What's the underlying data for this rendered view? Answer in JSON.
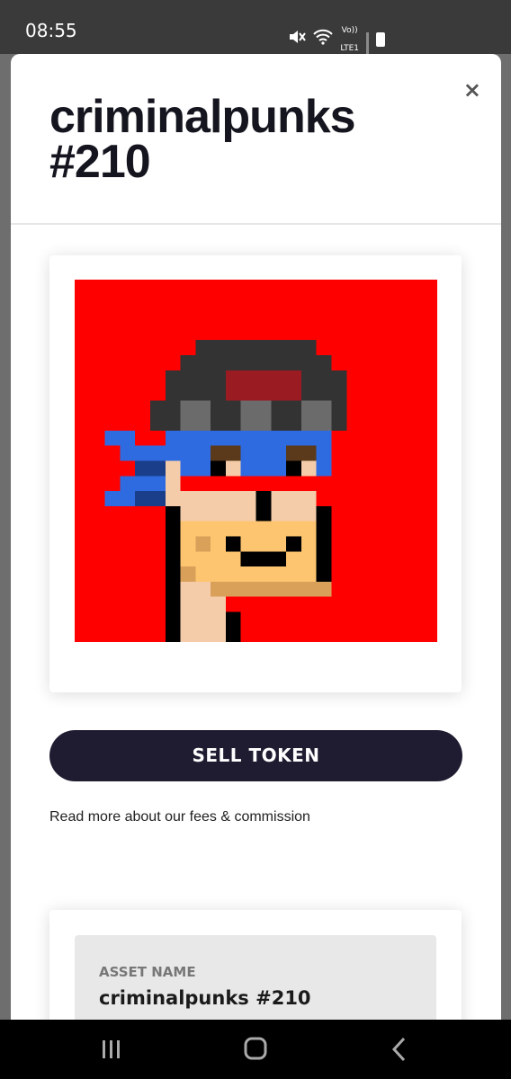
{
  "status_bar": {
    "time": "08:55",
    "icons": [
      "mute-icon",
      "wifi-icon",
      "volte-icon",
      "signal-icon",
      "battery-icon"
    ],
    "volte_top": "Vo))",
    "volte_bottom": "LTE1"
  },
  "sheet": {
    "title": "criminalpunks #210",
    "close_label": "×"
  },
  "nft": {
    "background": "#ff0000",
    "alt": "criminalpunks #210 pixel art"
  },
  "actions": {
    "sell_label": "SELL TOKEN",
    "fees_link": "Read more about our fees & commission"
  },
  "details": {
    "asset_name_label": "ASSET NAME",
    "asset_name_value": "criminalpunks #210"
  },
  "nav": {
    "icons": [
      "recents-icon",
      "home-icon",
      "back-icon"
    ]
  },
  "colors": {
    "primary_button": "#1f1c31",
    "title_text": "#15151f"
  }
}
